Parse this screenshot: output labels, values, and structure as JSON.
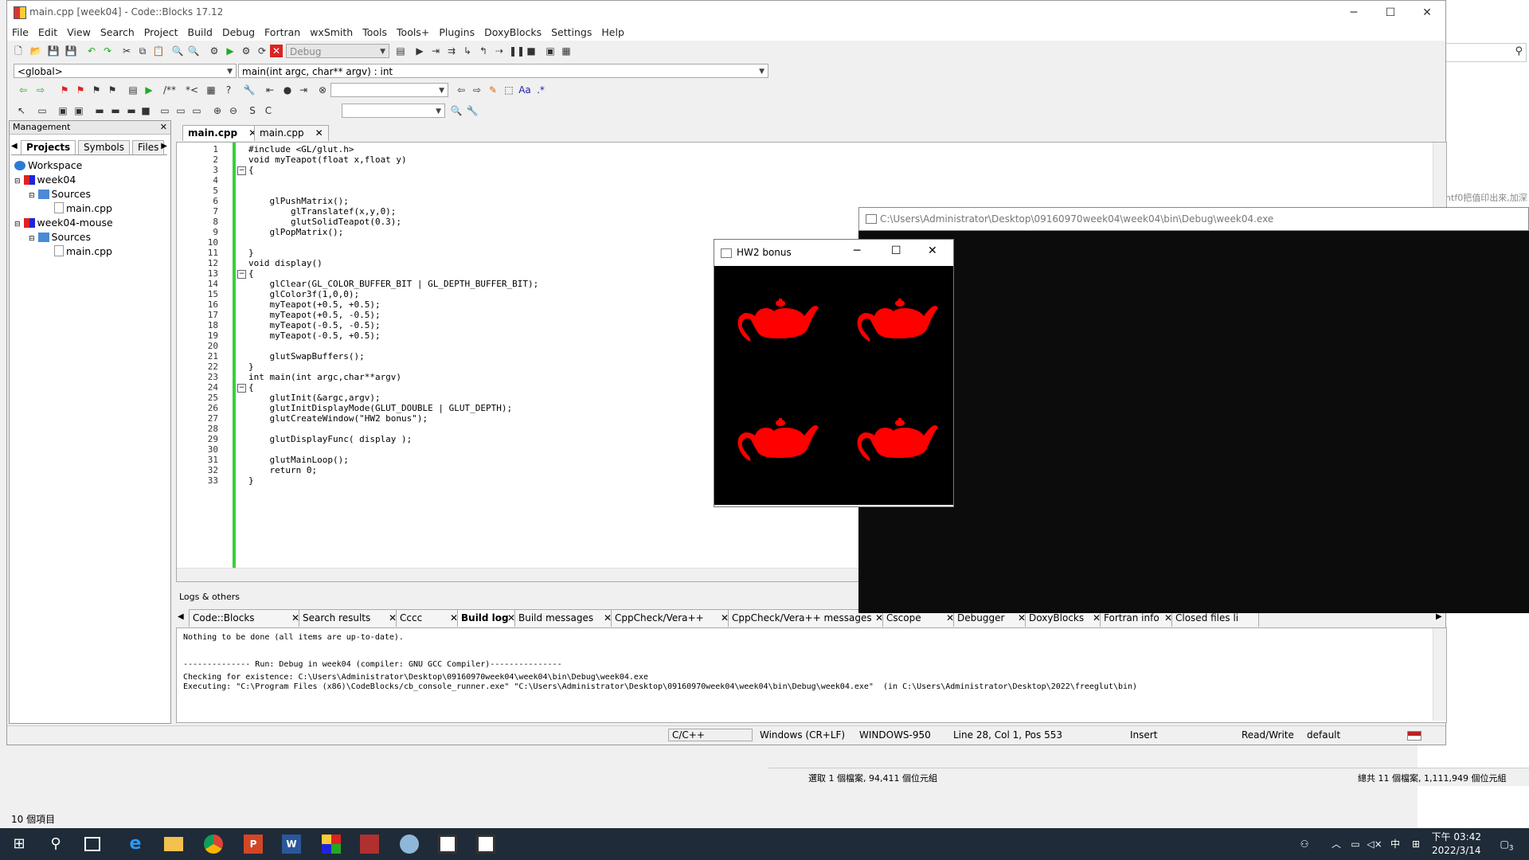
{
  "window": {
    "title": "main.cpp [week04] - Code::Blocks 17.12"
  },
  "menu": [
    "File",
    "Edit",
    "View",
    "Search",
    "Project",
    "Build",
    "Debug",
    "Fortran",
    "wxSmith",
    "Tools",
    "Tools+",
    "Plugins",
    "DoxyBlocks",
    "Settings",
    "Help"
  ],
  "toolbar": {
    "build_target": "Debug",
    "scope": "<global>",
    "function": "main(int argc, char** argv) : int"
  },
  "management": {
    "title": "Management",
    "tabs": [
      "Projects",
      "Symbols",
      "Files"
    ],
    "tree": [
      {
        "label": "Workspace",
        "level": 0
      },
      {
        "label": "week04",
        "level": 1,
        "bold": true
      },
      {
        "label": "Sources",
        "level": 2
      },
      {
        "label": "main.cpp",
        "level": 3
      },
      {
        "label": "week04-mouse",
        "level": 1
      },
      {
        "label": "Sources",
        "level": 2
      },
      {
        "label": "main.cpp",
        "level": 3
      }
    ]
  },
  "editor": {
    "tabs": [
      "main.cpp",
      "main.cpp"
    ],
    "lines": [
      "#include <GL/glut.h>",
      "void myTeapot(float x,float y)",
      "{",
      "",
      "",
      "    glPushMatrix();",
      "        glTranslatef(x,y,0);",
      "        glutSolidTeapot(0.3);",
      "    glPopMatrix();",
      "",
      "}",
      "void display()",
      "{",
      "    glClear(GL_COLOR_BUFFER_BIT | GL_DEPTH_BUFFER_BIT);",
      "    glColor3f(1,0,0);",
      "    myTeapot(+0.5, +0.5);",
      "    myTeapot(+0.5, -0.5);",
      "    myTeapot(-0.5, -0.5);",
      "    myTeapot(-0.5, +0.5);",
      "",
      "    glutSwapBuffers();",
      "}",
      "int main(int argc,char**argv)",
      "{",
      "    glutInit(&argc,argv);",
      "    glutInitDisplayMode(GLUT_DOUBLE | GLUT_DEPTH);",
      "    glutCreateWindow(\"HW2 bonus\");",
      "",
      "    glutDisplayFunc( display );",
      "",
      "    glutMainLoop();",
      "    return 0;",
      "}"
    ]
  },
  "logs": {
    "title": "Logs & others",
    "tabs": [
      "Code::Blocks",
      "Search results",
      "Cccc",
      "Build log",
      "Build messages",
      "CppCheck/Vera++",
      "CppCheck/Vera++ messages",
      "Cscope",
      "Debugger",
      "DoxyBlocks",
      "Fortran info",
      "Closed files li"
    ],
    "lines": [
      "Nothing to be done (all items are up-to-date).",
      "",
      "",
      "-------------- Run: Debug in week04 (compiler: GNU GCC Compiler)---------------",
      "Checking for existence: C:\\Users\\Administrator\\Desktop\\09160970week04\\week04\\bin\\Debug\\week04.exe",
      "Executing: \"C:\\Program Files (x86)\\CodeBlocks/cb_console_runner.exe\" \"C:\\Users\\Administrator\\Desktop\\09160970week04\\week04\\bin\\Debug\\week04.exe\"  (in C:\\Users\\Administrator\\Desktop\\2022\\freeglut\\bin)"
    ]
  },
  "status": {
    "lang": "C/C++",
    "eol": "Windows (CR+LF)",
    "encoding": "WINDOWS-950",
    "pos": "Line 28, Col 1, Pos 553",
    "mode": "Insert",
    "rw": "Read/Write",
    "profile": "default"
  },
  "console": {
    "title": "C:\\Users\\Administrator\\Desktop\\09160970week04\\week04\\bin\\Debug\\week04.exe"
  },
  "glwindow": {
    "title": "HW2 bonus"
  },
  "explorer": {
    "selected": "選取 1 個檔案, 94,411 個位元組",
    "total": "總共 11 個檔案, 1,111,949 個位元組",
    "count": "10 個項目",
    "snippet": "intf0把值印出來,加深"
  },
  "taskbar": {
    "time": "下午 03:42",
    "date": "2022/3/14",
    "ime": "中",
    "notif": "3"
  }
}
